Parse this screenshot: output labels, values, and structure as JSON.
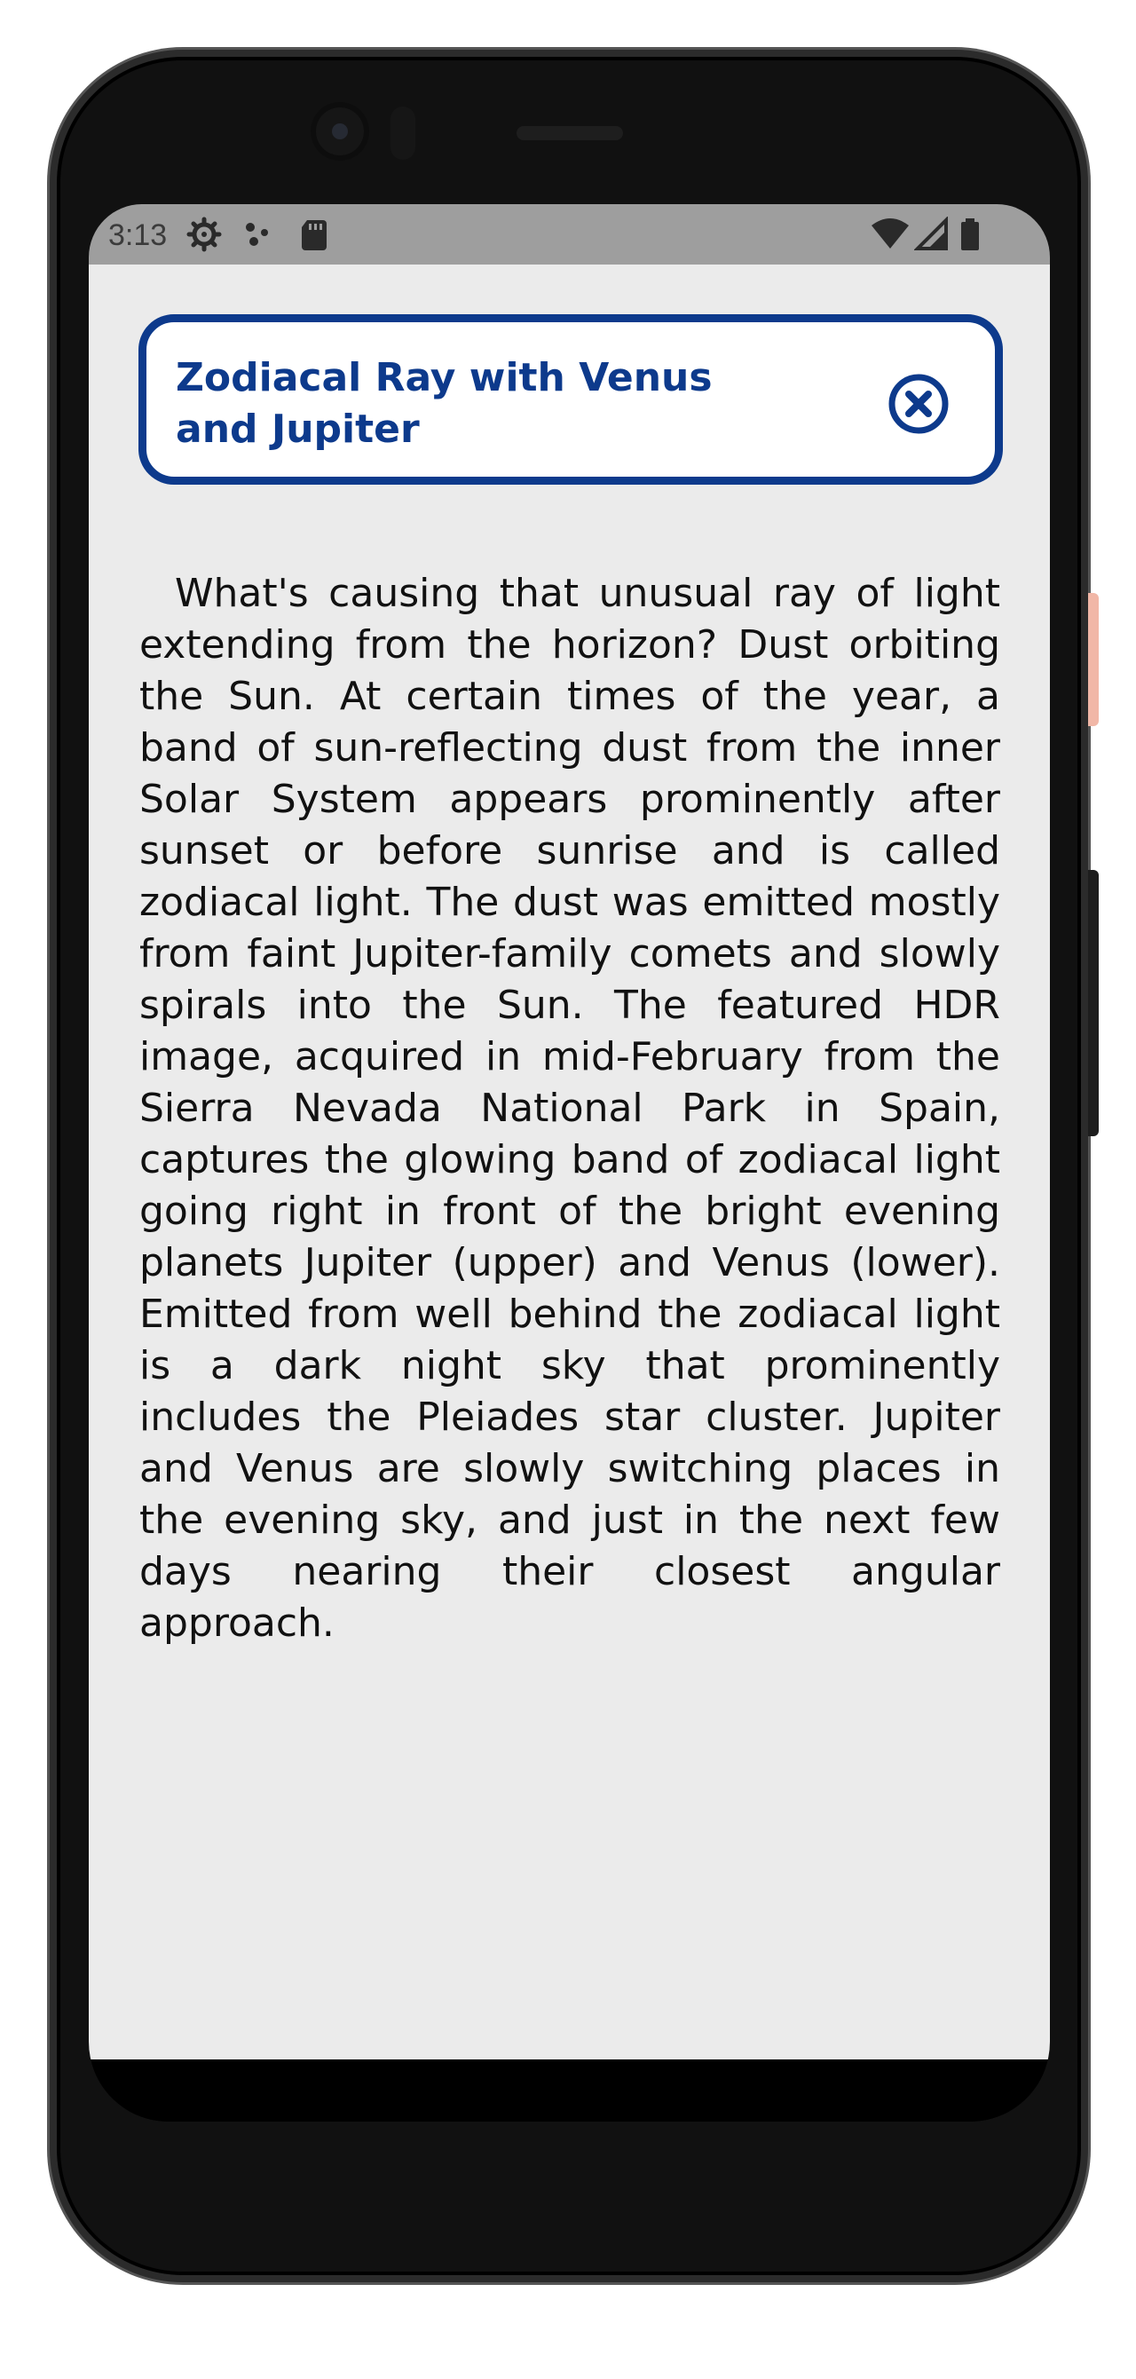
{
  "status_bar": {
    "time": "3:13",
    "left_icons": [
      "settings-gear-icon",
      "notification-dots-icon",
      "sd-card-icon"
    ],
    "right_icons": [
      "wifi-icon",
      "cell-signal-icon",
      "battery-icon"
    ]
  },
  "header": {
    "title": "Zodiacal Ray with Venus and Jupiter",
    "close_icon": "close-circle-icon"
  },
  "article": {
    "body": "What's causing that unusual ray of light extending from the horizon? Dust orbiting the Sun. At certain times of the year, a band of sun-reflecting dust from the inner Solar System appears prominently after sunset or before sunrise and is called zodiacal light.  The dust was emitted mostly from faint Jupiter-family comets and slowly spirals into the Sun. The featured HDR image, acquired in mid-February from the Sierra Nevada National Park in Spain, captures the glowing band of zodiacal light going right in front of the bright evening planets Jupiter (upper) and Venus (lower). Emitted from well behind the zodiacal light is a dark night sky that prominently includes the Pleiades star cluster. Jupiter and Venus are slowly switching places in the evening sky, and just in the next few days nearing their closest angular approach."
  },
  "colors": {
    "accent": "#0d3a8c",
    "background": "#ebebeb",
    "status_bar": "#9e9e9e"
  }
}
